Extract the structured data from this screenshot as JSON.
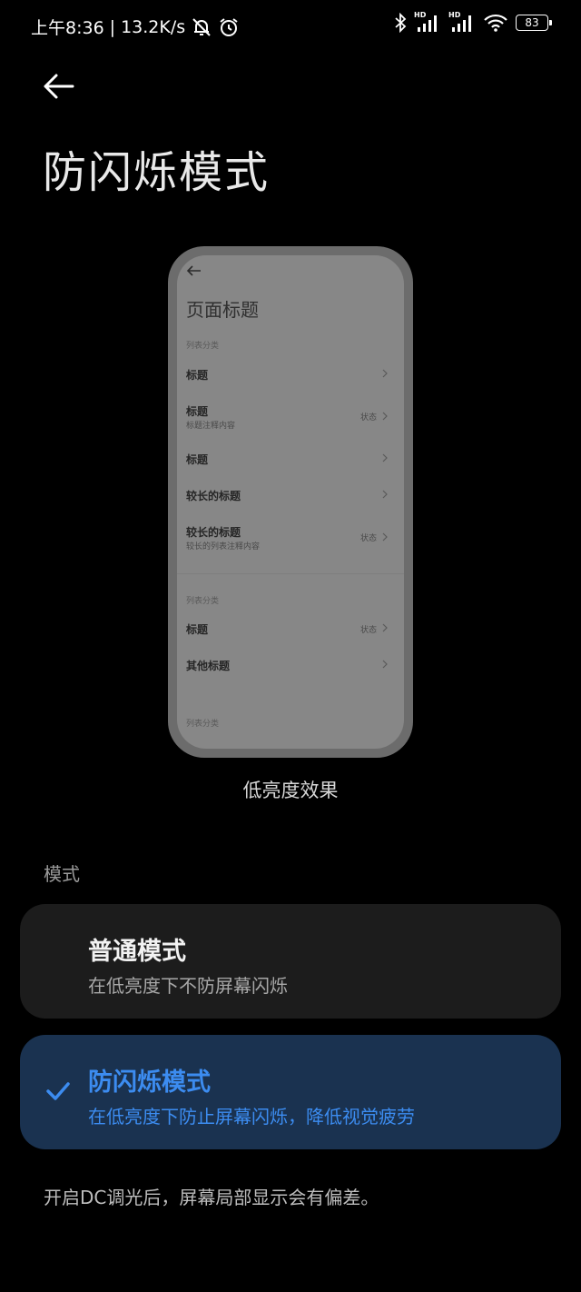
{
  "status_bar": {
    "time": "上午8:36",
    "separator": "|",
    "net_speed": "13.2K/s",
    "hd1": "HD",
    "hd2": "HD",
    "battery": "83",
    "icons": [
      "mute-bell-icon",
      "alarm-icon",
      "bluetooth-icon",
      "signal-icon",
      "signal-icon",
      "wifi-icon",
      "battery-icon"
    ]
  },
  "header": {
    "title": "防闪烁模式"
  },
  "preview": {
    "page_title": "页面标题",
    "section1": "列表分类",
    "rows1": [
      {
        "label": "标题",
        "sub": "",
        "state": ""
      },
      {
        "label": "标题",
        "sub": "标题注释内容",
        "state": "状态"
      },
      {
        "label": "标题",
        "sub": "",
        "state": ""
      },
      {
        "label": "较长的标题",
        "sub": "",
        "state": ""
      },
      {
        "label": "较长的标题",
        "sub": "较长的列表注释内容",
        "state": "状态"
      }
    ],
    "section2": "列表分类",
    "rows2": [
      {
        "label": "标题",
        "state": "状态"
      },
      {
        "label": "其他标题",
        "state": ""
      }
    ],
    "section3": "列表分类",
    "caption": "低亮度效果"
  },
  "mode_section": {
    "label": "模式",
    "options": [
      {
        "title": "普通模式",
        "subtitle": "在低亮度下不防屏幕闪烁",
        "selected": false
      },
      {
        "title": "防闪烁模式",
        "subtitle": "在低亮度下防止屏幕闪烁，降低视觉疲劳",
        "selected": true
      }
    ]
  },
  "footer_note": "开启DC调光后，屏幕局部显示会有偏差。",
  "colors": {
    "accent": "#3c8cf0",
    "selected_card": "#1a3250",
    "card": "#1c1c1c",
    "background": "#000000"
  }
}
